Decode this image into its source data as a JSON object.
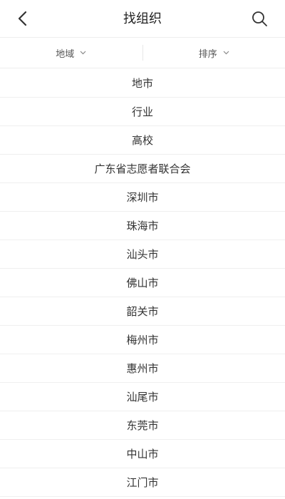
{
  "header": {
    "title": "找组织",
    "back_icon": "chevron-left-icon",
    "search_icon": "search-icon"
  },
  "filters": [
    {
      "label": "地域",
      "icon": "chevron-down-icon"
    },
    {
      "label": "排序",
      "icon": "chevron-down-icon"
    }
  ],
  "list": {
    "items": [
      {
        "label": "地市"
      },
      {
        "label": "行业"
      },
      {
        "label": "高校"
      },
      {
        "label": "广东省志愿者联合会"
      },
      {
        "label": "深圳市"
      },
      {
        "label": "珠海市"
      },
      {
        "label": "汕头市"
      },
      {
        "label": "佛山市"
      },
      {
        "label": "韶关市"
      },
      {
        "label": "梅州市"
      },
      {
        "label": "惠州市"
      },
      {
        "label": "汕尾市"
      },
      {
        "label": "东莞市"
      },
      {
        "label": "中山市"
      },
      {
        "label": "江门市"
      }
    ]
  }
}
